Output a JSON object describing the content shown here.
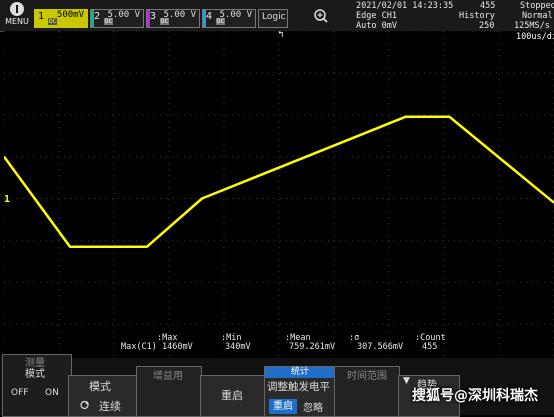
{
  "menu": {
    "label": "MENU"
  },
  "channels": [
    {
      "num": "1",
      "value": "500mV",
      "coupling": "DC"
    },
    {
      "num": "2",
      "value": "5.00 V",
      "coupling": "DC"
    },
    {
      "num": "3",
      "value": "5.00 V",
      "coupling": "DC"
    },
    {
      "num": "4",
      "value": "5.00 V",
      "coupling": "DC"
    }
  ],
  "logic": {
    "label": "Logic"
  },
  "status": {
    "datetime": "2021/02/01 14:23:35",
    "acq_count": "455",
    "run_state": "Stopped",
    "trigger_line1": "Edge CH1",
    "trigger_line2": "Auto 0mV",
    "history_label": "History",
    "history_value": "250",
    "mode_label": "Normal",
    "sample_rate": "125MS/s",
    "timebase": "100us/div"
  },
  "measurements": {
    "headers": [
      ":Max",
      ":Min",
      ":Mean",
      ":σ",
      ":Count"
    ],
    "row_label": "Max(C1)",
    "values": [
      "1460mV",
      "340mV",
      "759.261mV",
      "307.566mV",
      "455"
    ]
  },
  "bottom_menu": {
    "measure_title": "测量",
    "mode_title": "模式",
    "off_label": "OFF",
    "on_label": "ON",
    "mode_label": "模式",
    "continuous_label": "连续",
    "hidden_label1": "增益用",
    "restart_label": "重启",
    "stats_tab": "统计",
    "adjust_trigger": "调整触发电平",
    "restart_btn": "重启",
    "ignore_btn": "忽略",
    "range_label": "时间范围",
    "trend_label": "趋势"
  },
  "watermark": "搜狐号@深圳科瑞杰",
  "colors": {
    "ch1": "#ffff00",
    "accent": "#1f6fc8",
    "grid": "#3a3a3a"
  },
  "chart_data": {
    "type": "line",
    "x": [
      0,
      1.2,
      2.6,
      3.6,
      7.3,
      8.1,
      10
    ],
    "values": [
      1,
      -1.15,
      -1.15,
      0,
      1.95,
      1.95,
      -0.1
    ],
    "ylim": [
      -4,
      4
    ],
    "xlim": [
      0,
      10
    ]
  }
}
